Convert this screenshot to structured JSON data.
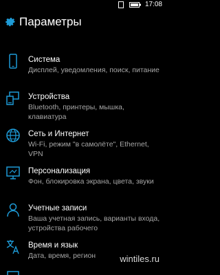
{
  "status_bar": {
    "time": "17:08",
    "icons": [
      "notification-icon",
      "battery-icon"
    ]
  },
  "header": {
    "icon": "gear-icon",
    "title": "Параметры"
  },
  "colors": {
    "accent": "#1e9bd7",
    "background": "#000000",
    "text": "#ffffff",
    "subtext": "#a6a6a6"
  },
  "items": [
    {
      "icon": "phone-icon",
      "title": "Система",
      "description": "Дисплей, уведомления, поиск, питание"
    },
    {
      "icon": "devices-icon",
      "title": "Устройства",
      "description": "Bluetooth, принтеры, мышка, клавиатура"
    },
    {
      "icon": "globe-icon",
      "title": "Сеть и Интернет",
      "description": "Wi-Fi, режим \"в самолёте\", Ethernet, VPN"
    },
    {
      "icon": "personalization-icon",
      "title": "Персонализация",
      "description": "Фон, блокировка экрана, цвета, звуки"
    },
    {
      "icon": "person-icon",
      "title": "Учетные записи",
      "description": "Ваша учетная запись, варианты входа, устройства рабочего"
    },
    {
      "icon": "language-icon",
      "title": "Время и язык",
      "description": "Дата, время, регион"
    }
  ],
  "watermark": "wintiles.ru"
}
